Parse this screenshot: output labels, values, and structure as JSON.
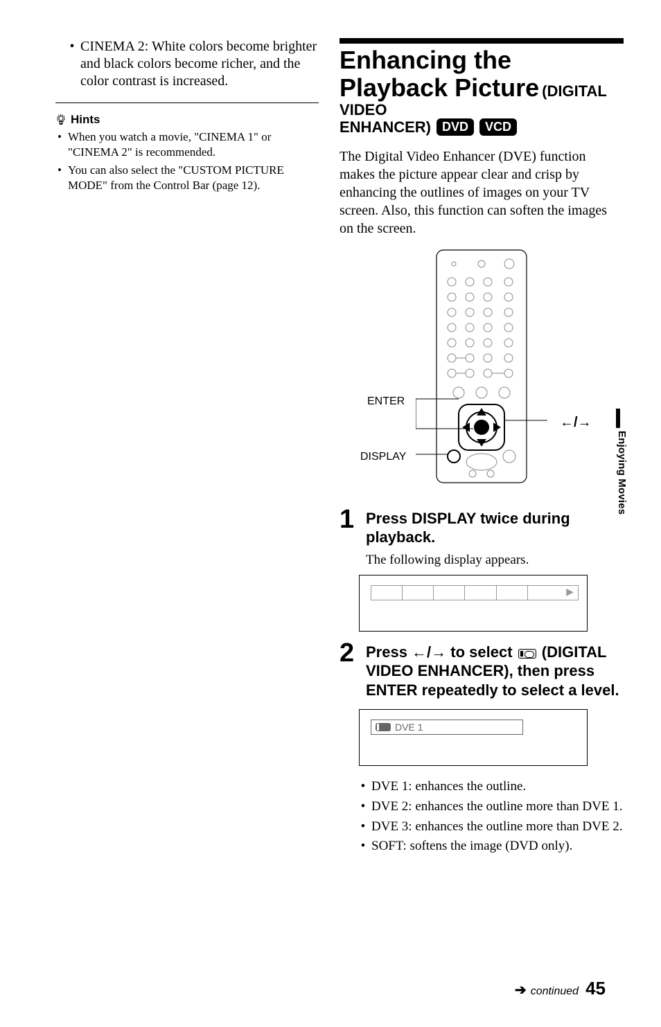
{
  "left": {
    "cinema2_text": "CINEMA 2: White colors become brighter and black colors become richer, and the color contrast is increased.",
    "hints_label": "Hints",
    "hint1": "When you watch a movie, \"CINEMA 1\" or \"CINEMA 2\" is recommended.",
    "hint2": "You can also select the \"CUSTOM PICTURE MODE\" from the Control Bar (page 12)."
  },
  "right": {
    "title_main": "Enhancing the Playback Picture",
    "title_sub1": "(DIGITAL VIDEO",
    "title_sub2": "ENHANCER)",
    "badge_dvd": "DVD",
    "badge_vcd": "VCD",
    "intro": "The Digital Video Enhancer (DVE) function makes the picture appear clear and crisp by enhancing the outlines of images on your TV screen. Also, this function can soften the images on the screen.",
    "remote_labels": {
      "enter": "ENTER",
      "display": "DISPLAY",
      "arrows": "←/→"
    },
    "step1_head": "Press DISPLAY twice during playback.",
    "step1_sub": "The following display appears.",
    "step2_head_pre": "Press ←/→ to select ",
    "step2_head_post": " (DIGITAL VIDEO ENHANCER), then press ENTER repeatedly to select a level.",
    "dve_label": "DVE 1",
    "dve_bullets": [
      "DVE 1: enhances the outline.",
      "DVE 2: enhances the outline more than DVE 1.",
      "DVE 3: enhances the outline more than DVE 2.",
      "SOFT: softens the image (DVD only)."
    ]
  },
  "side_tab": "Enjoying Movies",
  "footer": {
    "arrow": "➔",
    "continued": "continued",
    "page": "45"
  },
  "chart_data": {
    "type": "table",
    "note": "no chart present"
  }
}
